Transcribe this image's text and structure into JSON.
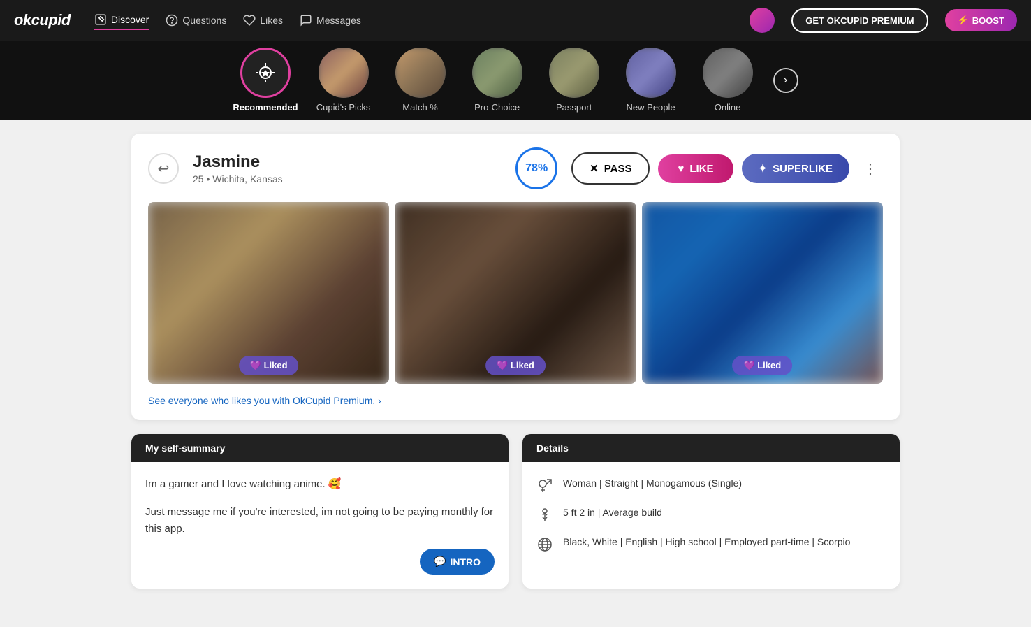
{
  "logo": "okcupid",
  "nav": {
    "items": [
      {
        "label": "Discover",
        "icon": "compass",
        "active": true
      },
      {
        "label": "Questions",
        "icon": "question"
      },
      {
        "label": "Likes",
        "icon": "heart"
      },
      {
        "label": "Messages",
        "icon": "message"
      }
    ],
    "premium_btn": "GET OKCUPID PREMIUM",
    "boost_btn": "BOOST"
  },
  "categories": [
    {
      "label": "Recommended",
      "active": true,
      "is_icon": true
    },
    {
      "label": "Cupid's Picks",
      "active": false
    },
    {
      "label": "Match %",
      "active": false
    },
    {
      "label": "Pro-Choice",
      "active": false
    },
    {
      "label": "Passport",
      "active": false
    },
    {
      "label": "New People",
      "active": false
    },
    {
      "label": "Online",
      "active": false
    }
  ],
  "profile": {
    "name": "Jasmine",
    "age": "25",
    "location": "Wichita, Kansas",
    "match_percent": "78%",
    "pass_label": "PASS",
    "like_label": "LIKE",
    "superlike_label": "SUPERLIKE",
    "photos_blurred": true,
    "photo_badges": [
      "",
      "",
      ""
    ],
    "premium_link": "See everyone who likes you with OkCupid Premium. ›"
  },
  "self_summary": {
    "header": "My self-summary",
    "text_line1": "Im a gamer and I love watching anime. 🥰",
    "text_line2": "Just message me if you're interested, im not going to be paying monthly for this app.",
    "intro_btn": "INTRO"
  },
  "details": {
    "header": "Details",
    "rows": [
      {
        "icon": "gender",
        "text": "Woman | Straight | Monogamous (Single)"
      },
      {
        "icon": "height",
        "text": "5 ft 2 in | Average build"
      },
      {
        "icon": "globe",
        "text": "Black, White | English | High school | Employed part-time | Scorpio"
      }
    ]
  }
}
